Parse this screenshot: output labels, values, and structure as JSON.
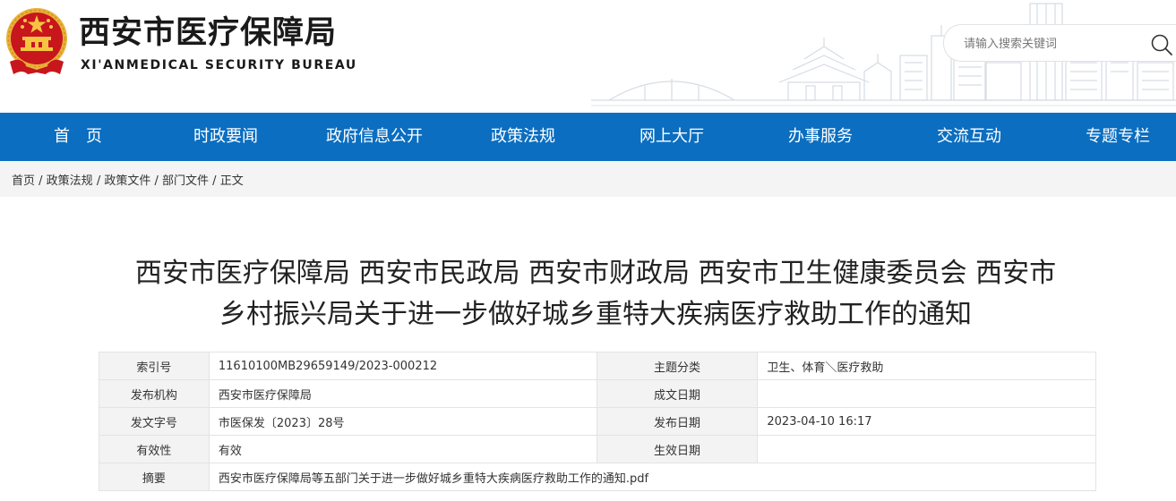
{
  "header": {
    "title": "西安市医疗保障局",
    "subtitle": "XI'ANMEDICAL SECURITY BUREAU",
    "emblem_icon": "national-emblem-icon",
    "search": {
      "placeholder": "请输入搜索关键词",
      "icon": "search-icon"
    }
  },
  "colors": {
    "nav_bg": "#0b6ec0",
    "crumb_bg": "#f4f4f4",
    "label_bg": "#f3f3f3",
    "emblem_red": "#c8161d",
    "emblem_gold": "#e9b33c"
  },
  "nav": {
    "items": [
      {
        "label": "首　页"
      },
      {
        "label": "时政要闻"
      },
      {
        "label": "政府信息公开"
      },
      {
        "label": "政策法规"
      },
      {
        "label": "网上大厅"
      },
      {
        "label": "办事服务"
      },
      {
        "label": "交流互动"
      },
      {
        "label": "专题专栏"
      }
    ]
  },
  "breadcrumb": {
    "items": [
      "首页",
      "政策法规",
      "政策文件",
      "部门文件",
      "正文"
    ],
    "separator": " / "
  },
  "document": {
    "title_line1": "西安市医疗保障局 西安市民政局 西安市财政局 西安市卫生健康委员会 西安市",
    "title_line2": "乡村振兴局关于进一步做好城乡重特大疾病医疗救助工作的通知"
  },
  "meta": {
    "index_label": "索引号",
    "index_value": "11610100MB29659149/2023-000212",
    "topic_label": "主题分类",
    "topic_value": "卫生、体育＼医疗救助",
    "issuer_label": "发布机构",
    "issuer_value": "西安市医疗保障局",
    "created_label": "成文日期",
    "created_value": "",
    "docno_label": "发文字号",
    "docno_value": "市医保发〔2023〕28号",
    "pubdate_label": "发布日期",
    "pubdate_value": "2023-04-10 16:17",
    "validity_label": "有效性",
    "validity_value": "有效",
    "effective_label": "生效日期",
    "effective_value": "",
    "abstract_label": "摘要",
    "abstract_value": "西安市医疗保障局等五部门关于进一步做好城乡重特大疾病医疗救助工作的通知.pdf"
  }
}
